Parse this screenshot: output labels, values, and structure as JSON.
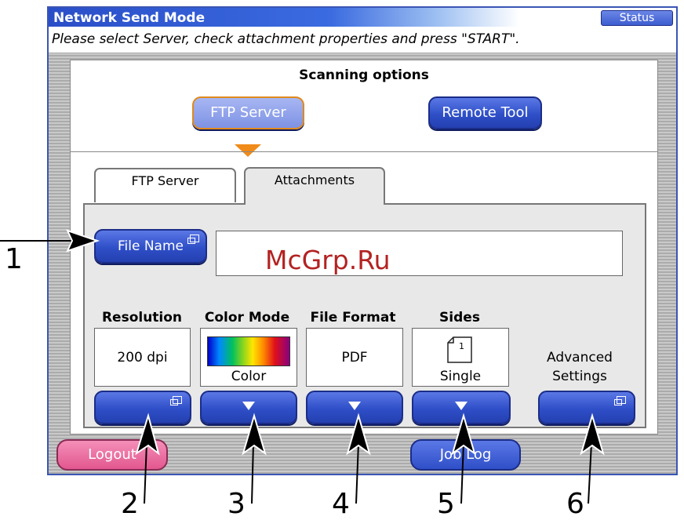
{
  "window": {
    "title": "Network Send Mode",
    "status_label": "Status"
  },
  "instruction": "Please select Server, check attachment properties and press \"START\".",
  "scanning": {
    "title": "Scanning options",
    "ftp_server_button": "FTP Server",
    "remote_tool_button": "Remote Tool"
  },
  "tabs": [
    {
      "label": "FTP Server"
    },
    {
      "label": "Attachments"
    }
  ],
  "file_name": {
    "label": "File Name",
    "value": ""
  },
  "columns": [
    {
      "label": "Resolution",
      "value": "200 dpi"
    },
    {
      "label": "Color Mode",
      "value": "Color"
    },
    {
      "label": "File Format",
      "value": "PDF"
    },
    {
      "label": "Sides",
      "value": "Single",
      "icon_number": "1"
    }
  ],
  "advanced": {
    "line1": "Advanced",
    "line2": "Settings"
  },
  "footer": {
    "logout": "Logout",
    "job_log": "Job Log"
  },
  "watermark": "McGrp.Ru",
  "callouts": [
    "1",
    "2",
    "3",
    "4",
    "5",
    "6"
  ],
  "colors": {
    "accent_blue": "#2f4fc8",
    "highlight_orange": "#f08b1a",
    "logout_pink": "#e2578f"
  }
}
